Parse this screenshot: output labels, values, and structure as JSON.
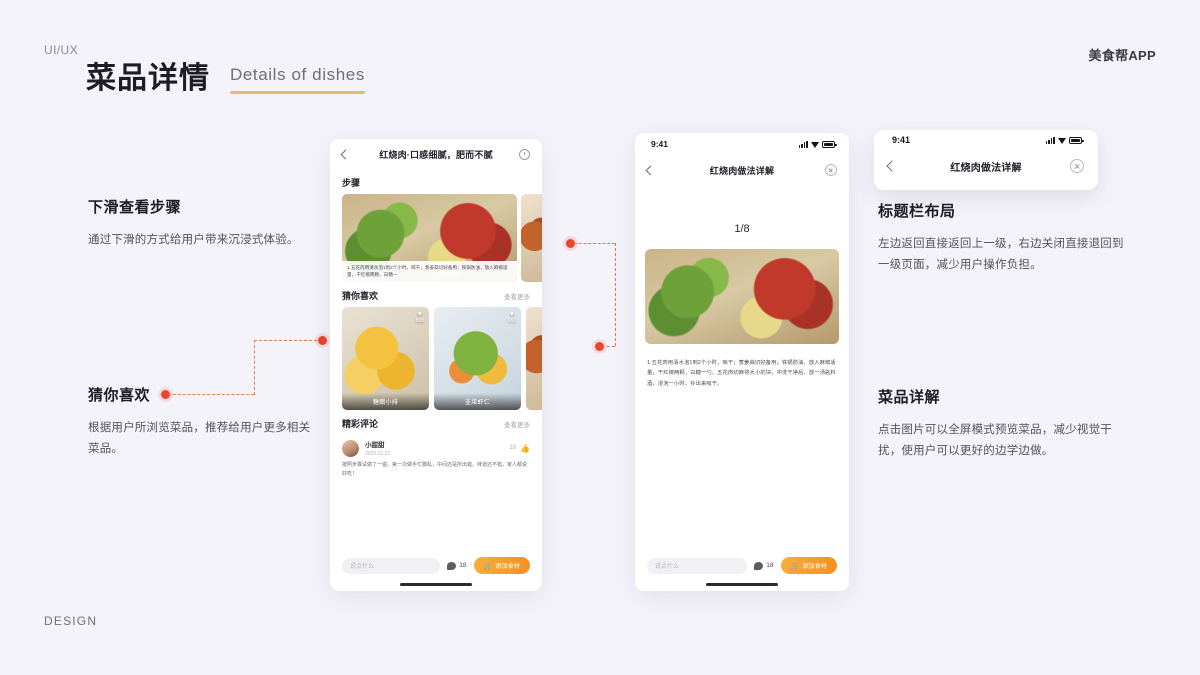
{
  "page": {
    "kicker": "UI/UX",
    "brand": "美食帮APP",
    "footer": "DESIGN",
    "title_cn": "菜品详情",
    "title_en": "Details of dishes",
    "accent_orange": "#f59020",
    "accent_underline": "#e8b974",
    "connector_color": "#e8452c",
    "background": "#f4f3fa"
  },
  "notes": [
    {
      "id": "scroll",
      "heading": "下滑查看步骤",
      "body": "通过下滑的方式给用户带来沉浸式体验。"
    },
    {
      "id": "guess",
      "heading": "猜你喜欢",
      "body": "根据用户所浏览菜品，推荐给用户更多相关菜品。"
    },
    {
      "id": "titlebar",
      "heading": "标题栏布局",
      "body": "左边返回直接返回上一级，右边关闭直接退回到一级页面，减少用户操作负担。"
    },
    {
      "id": "detail",
      "heading": "菜品详解",
      "body": "点击图片可以全屏模式预览菜品，减少视觉干扰，使用户可以更好的边学边做。"
    }
  ],
  "phone1": {
    "nav": {
      "title": "红烧肉·口感细腻，肥而不腻",
      "back_icon": "chevron-left-icon",
      "right_icon": "timer-icon"
    },
    "steps_section": {
      "title": "步骤",
      "cards": [
        {
          "caption": "1.五花肉用清水泡1到2个小时，晾干；葱姜蒜切好备用；铁锅防油，放入麻椒适量，干红椒两颗，白糖一"
        }
      ]
    },
    "guess_section": {
      "title": "猜你喜欢",
      "more": "查看更多",
      "dishes": [
        {
          "name": "糖醋小排",
          "likes": "888",
          "icon": "heart-icon"
        },
        {
          "name": "韭菜虾仁",
          "likes": "666",
          "icon": "heart-icon"
        }
      ]
    },
    "comments_section": {
      "title": "精彩评论",
      "more": "查看更多",
      "comment": {
        "user": "小甜甜",
        "date": "2020.12.22",
        "likes": "18",
        "text": "按照步骤试做了一遍，第一次做手忙脚乱，中间还是所出错，味道还不错，家人都说好吃！"
      }
    },
    "bottom": {
      "input_placeholder": "说点什么",
      "comment_count": "18",
      "comment_icon": "comment-bubble-icon",
      "add_label": "添加食材",
      "cart_icon": "cart-icon"
    }
  },
  "phone2": {
    "status": {
      "time": "9:41",
      "signal_icon": "signal-icon",
      "wifi_icon": "wifi-icon",
      "battery_icon": "battery-icon"
    },
    "nav": {
      "title": "红烧肉做法详解",
      "back_icon": "chevron-left-icon",
      "close_icon": "close-circle-icon"
    },
    "pager": "1/8",
    "step_text": "1.五花肉用清水泡1到2个小时，晾干；葱姜蒜切好备用；铁锅防油，放入麻椒适量，干红椒两颗，白糖一勺，五花肉切麻将大小的块，冲洗干净后，放一汤匙料酒，浸泡一小时，拎出来吸干。",
    "bottom": {
      "input_placeholder": "说点什么",
      "comment_count": "18",
      "comment_icon": "comment-bubble-icon",
      "add_label": "添加食材",
      "cart_icon": "cart-icon"
    }
  },
  "zoomcard": {
    "status": {
      "time": "9:41"
    },
    "nav": {
      "title": "红烧肉做法详解",
      "back_icon": "chevron-left-icon",
      "close_icon": "close-circle-icon"
    }
  }
}
